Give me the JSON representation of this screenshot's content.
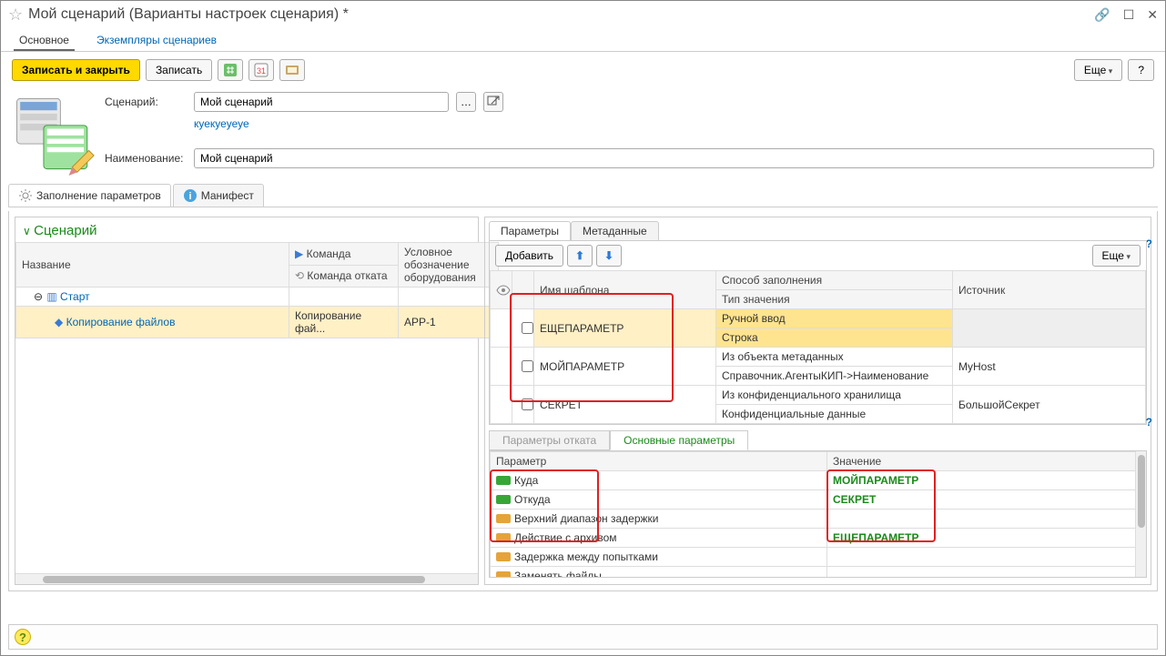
{
  "window": {
    "title": "Мой сценарий (Варианты настроек сценария) *"
  },
  "main_tabs": {
    "main": "Основное",
    "instances": "Экземпляры сценариев"
  },
  "toolbar": {
    "save_close": "Записать и закрыть",
    "save": "Записать",
    "more": "Еще",
    "help": "?"
  },
  "form": {
    "scenario_label": "Сценарий:",
    "scenario_value": "Мой сценарий",
    "sub_link": "куекуеуеуе",
    "name_label": "Наименование:",
    "name_value": "Мой сценарий"
  },
  "panel_tabs": {
    "fill_params": "Заполнение параметров",
    "manifest": "Манифест"
  },
  "scenario_tree": {
    "section": "Сценарий",
    "cols": {
      "name": "Название",
      "command": "Команда",
      "rollback": "Команда отката",
      "equipment": "Условное обозначение оборудования"
    },
    "root": "Старт",
    "step": {
      "name": "Копирование файлов",
      "command": "Копирование фай...",
      "equipment": "APP-1"
    }
  },
  "params_panel": {
    "tabs": {
      "params": "Параметры",
      "meta": "Метаданные"
    },
    "add": "Добавить",
    "more": "Еще",
    "cols": {
      "template_name": "Имя шаблона",
      "fill_method": "Способ заполнения",
      "value_type": "Тип значения",
      "source": "Источник"
    },
    "rows": [
      {
        "name": "ЕЩЕПАРАМЕТР",
        "method": "Ручной ввод",
        "vtype": "Строка",
        "source": ""
      },
      {
        "name": "МОЙПАРАМЕТР",
        "method": "Из объекта метаданных",
        "vtype": "Справочник.АгентыКИП->Наименование",
        "source": "MyHost"
      },
      {
        "name": "СЕКРЕТ",
        "method": "Из конфиденциального хранилища",
        "vtype": "Конфиденциальные данные",
        "source": "БольшойСекрет"
      }
    ]
  },
  "bottom_panel": {
    "tabs": {
      "rollback": "Параметры отката",
      "main": "Основные параметры"
    },
    "cols": {
      "param": "Параметр",
      "value": "Значение"
    },
    "rows": [
      {
        "icon": "green",
        "param": "Куда",
        "value": "МОЙПАРАМЕТР"
      },
      {
        "icon": "green",
        "param": "Откуда",
        "value": "СЕКРЕТ"
      },
      {
        "icon": "yellow",
        "param": "Верхний диапазон задержки",
        "value": ""
      },
      {
        "icon": "yellow",
        "param": "Действие с архивом",
        "value": "ЕЩЕПАРАМЕТР"
      },
      {
        "icon": "yellow",
        "param": "Задержка между попытками",
        "value": ""
      },
      {
        "icon": "yellow",
        "param": "Заменять файлы",
        "value": ""
      }
    ]
  }
}
